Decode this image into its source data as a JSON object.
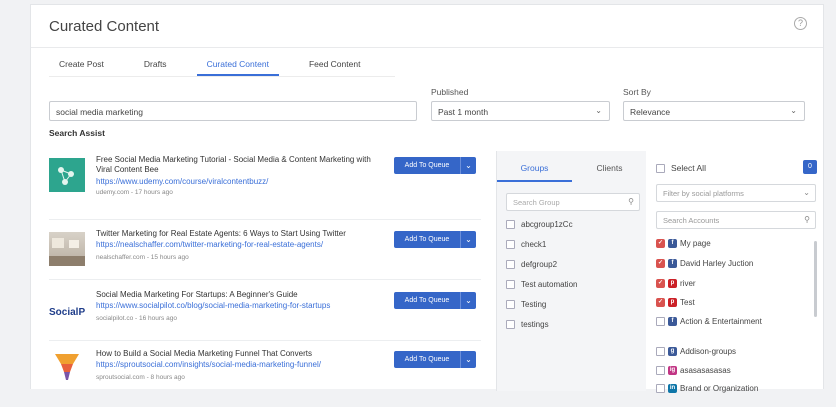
{
  "page": {
    "title": "Curated Content",
    "help": "?"
  },
  "tabs": [
    {
      "label": "Create Post",
      "active": false
    },
    {
      "label": "Drafts",
      "active": false
    },
    {
      "label": "Curated Content",
      "active": true
    },
    {
      "label": "Feed Content",
      "active": false
    }
  ],
  "filters": {
    "search_value": "social media marketing",
    "published_label": "Published",
    "published_value": "Past 1 month",
    "sortby_label": "Sort By",
    "sortby_value": "Relevance",
    "search_assist": "Search Assist"
  },
  "results": [
    {
      "title": "Free Social Media Marketing Tutorial - Social Media & Content Marketing with Viral Content Bee",
      "url": "https://www.udemy.com/course/viralcontentbuzz/",
      "meta": "udemy.com - 17 hours ago",
      "thumb": "udemy-thumb"
    },
    {
      "title": "Twitter Marketing for Real Estate Agents: 6 Ways to Start Using Twitter",
      "url": "https://nealschaffer.com/twitter-marketing-for-real-estate-agents/",
      "meta": "nealschaffer.com - 15 hours ago",
      "thumb": "room-thumb"
    },
    {
      "title": "Social Media Marketing For Startups: A Beginner's Guide",
      "url": "https://www.socialpilot.co/blog/social-media-marketing-for-startups",
      "meta": "socialpilot.co - 16 hours ago",
      "thumb": "socialpilot-thumb"
    },
    {
      "title": "How to Build a Social Media Marketing Funnel That Converts",
      "url": "https://sproutsocial.com/insights/social-media-marketing-funnel/",
      "meta": "sproutsocial.com - 8 hours ago",
      "thumb": "funnel-thumb"
    }
  ],
  "queue_button": {
    "label": "Add To Queue",
    "dropdown": "chevron-down-icon"
  },
  "groups_panel": {
    "tabs": [
      "Groups",
      "Clients"
    ],
    "search_placeholder": "Search Group",
    "groups": [
      "abcgroup1zCc",
      "check1",
      "defgroup2",
      "Test automation",
      "Testing",
      "testings"
    ]
  },
  "accounts_panel": {
    "select_all": "Select All",
    "count": "0",
    "filter_placeholder": "Filter by social platforms",
    "search_placeholder": "Search Accounts",
    "accounts": [
      {
        "name": "My page",
        "platform": "facebook",
        "checked": true
      },
      {
        "name": "David Harley Juction",
        "platform": "facebook",
        "checked": true
      },
      {
        "name": "river",
        "platform": "pinterest",
        "checked": true
      },
      {
        "name": "Test",
        "platform": "pinterest",
        "checked": true
      },
      {
        "name": "Action & Entertainment",
        "platform": "facebook",
        "checked": false
      },
      {
        "name": "Addison-groups",
        "platform": "facebook-group",
        "checked": false
      },
      {
        "name": "asasasasasas",
        "platform": "instagram",
        "checked": false
      },
      {
        "name": "Brand or Organization",
        "platform": "linkedin",
        "checked": false
      }
    ]
  },
  "colors": {
    "accent": "#3566c8",
    "link": "#3a6fd8",
    "checked": "#d9534f"
  }
}
